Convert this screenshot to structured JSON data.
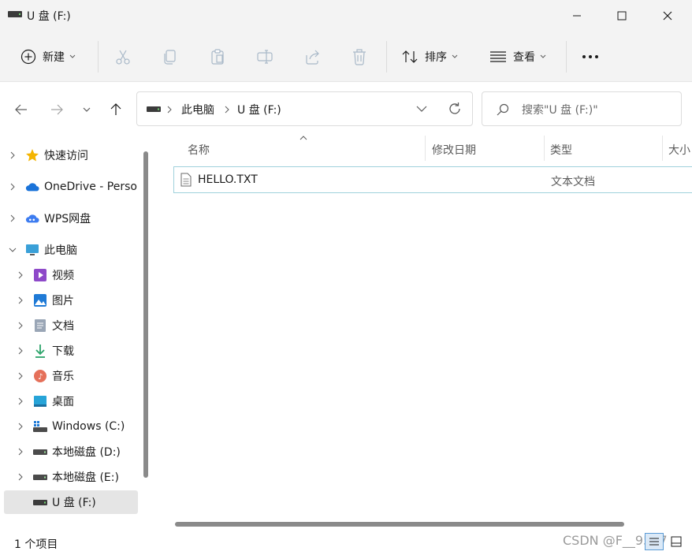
{
  "window": {
    "title": "U 盘 (F:)",
    "minimize_icon": "minimize-icon",
    "maximize_icon": "maximize-icon",
    "close_icon": "close-icon"
  },
  "toolbar": {
    "new_label": "新建",
    "sort_label": "排序",
    "view_label": "查看",
    "more_icon": "more-icon",
    "buttons": [
      "cut-icon",
      "copy-icon",
      "paste-icon",
      "rename-icon",
      "share-icon",
      "delete-icon"
    ]
  },
  "address": {
    "crumbs": [
      "此电脑",
      "U 盘 (F:)"
    ],
    "search_placeholder": "搜索\"U 盘 (F:)\""
  },
  "sidebar": {
    "items": [
      {
        "label": "快速访问",
        "icon": "star-icon",
        "expanded": false
      },
      {
        "label": "OneDrive - Perso",
        "icon": "onedrive-cloud-icon",
        "expanded": false
      },
      {
        "label": "WPS网盘",
        "icon": "wps-cloud-icon",
        "expanded": false
      },
      {
        "label": "此电脑",
        "icon": "computer-icon",
        "expanded": true
      },
      {
        "label": "视频",
        "icon": "video-icon",
        "expanded": false
      },
      {
        "label": "图片",
        "icon": "pictures-icon",
        "expanded": false
      },
      {
        "label": "文档",
        "icon": "documents-icon",
        "expanded": false
      },
      {
        "label": "下载",
        "icon": "download-icon",
        "expanded": false
      },
      {
        "label": "音乐",
        "icon": "music-icon",
        "expanded": false
      },
      {
        "label": "桌面",
        "icon": "desktop-icon",
        "expanded": false
      },
      {
        "label": "Windows (C:)",
        "icon": "windows-drive-icon",
        "expanded": false
      },
      {
        "label": "本地磁盘 (D:)",
        "icon": "drive-icon",
        "expanded": false
      },
      {
        "label": "本地磁盘 (E:)",
        "icon": "drive-icon",
        "expanded": false
      },
      {
        "label": "U 盘 (F:)",
        "icon": "usb-drive-icon",
        "expanded": false,
        "selected": true
      }
    ]
  },
  "columns": {
    "name": "名称",
    "modified": "修改日期",
    "type": "类型",
    "size": "大小"
  },
  "files": [
    {
      "name": "HELLO.TXT",
      "modified": "",
      "type": "文本文档",
      "size": "",
      "icon": "text-file-icon"
    }
  ],
  "status": {
    "count": "1 个项目"
  },
  "watermark": "CSDN @F__9527"
}
